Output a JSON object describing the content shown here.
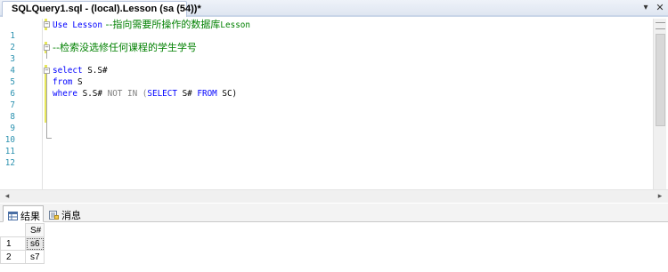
{
  "document_tab": {
    "title": "SQLQuery1.sql - (local).Lesson (sa (54))*"
  },
  "tabstrip_buttons": {
    "menu": "▾",
    "close": "✕"
  },
  "editor": {
    "lines": [
      {
        "n": "1",
        "a": "Use Lesson",
        "b": " --指向需要所操作的数据库",
        "c": "Lesson"
      },
      {
        "n": "2"
      },
      {
        "n": "3",
        "b": "--检索没选修任何课程的学生学号"
      },
      {
        "n": "4"
      },
      {
        "n": "5",
        "a": "select",
        "d": " S.S#"
      },
      {
        "n": "6",
        "a": "from",
        "d": " S"
      },
      {
        "n": "7",
        "a": "where",
        "d": " S.S#",
        "e": " NOT IN ",
        "f": "(",
        "g": "SELECT",
        "h": " S# ",
        "i": "FROM",
        "j": " SC)"
      },
      {
        "n": "8"
      },
      {
        "n": "9"
      },
      {
        "n": "10"
      },
      {
        "n": "11"
      },
      {
        "n": "12"
      }
    ]
  },
  "scrollbars": {
    "left_arrow": "◂",
    "right_arrow": "▸"
  },
  "results_tabs": [
    {
      "label": "结果",
      "icon": "grid-results-icon"
    },
    {
      "label": "消息",
      "icon": "messages-icon"
    }
  ],
  "results_grid": {
    "columns": [
      "S#"
    ],
    "rows": [
      {
        "row_number": "1",
        "values": [
          "s6"
        ]
      },
      {
        "row_number": "2",
        "values": [
          "s7"
        ]
      }
    ]
  }
}
